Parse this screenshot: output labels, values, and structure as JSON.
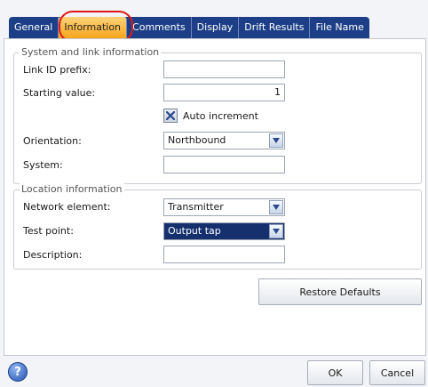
{
  "tabs": [
    {
      "label": "General"
    },
    {
      "label": "Information"
    },
    {
      "label": "Comments"
    },
    {
      "label": "Display"
    },
    {
      "label": "Drift Results"
    },
    {
      "label": "File Name"
    }
  ],
  "active_tab": "Information",
  "system_group": {
    "title": "System and link information",
    "link_id_prefix": {
      "label": "Link ID prefix:",
      "value": ""
    },
    "starting_value": {
      "label": "Starting value:",
      "value": "1"
    },
    "auto_increment": {
      "label": "Auto increment",
      "checked": true
    },
    "orientation": {
      "label": "Orientation:",
      "value": "Northbound"
    },
    "system": {
      "label": "System:",
      "value": ""
    }
  },
  "location_group": {
    "title": "Location information",
    "network_element": {
      "label": "Network element:",
      "value": "Transmitter"
    },
    "test_point": {
      "label": "Test point:",
      "value": "Output tap"
    },
    "description": {
      "label": "Description:",
      "value": ""
    }
  },
  "buttons": {
    "restore_defaults": "Restore Defaults",
    "ok": "OK",
    "cancel": "Cancel"
  },
  "icons": {
    "help": "help-icon",
    "checkbox": "checkbox-x-icon",
    "dropdown": "chevron-down-icon"
  },
  "colors": {
    "tab_bar": "#1d3f87",
    "active_tab": "#f7a51c",
    "highlight_circle": "#e01818",
    "selected_field": "#16306e"
  }
}
